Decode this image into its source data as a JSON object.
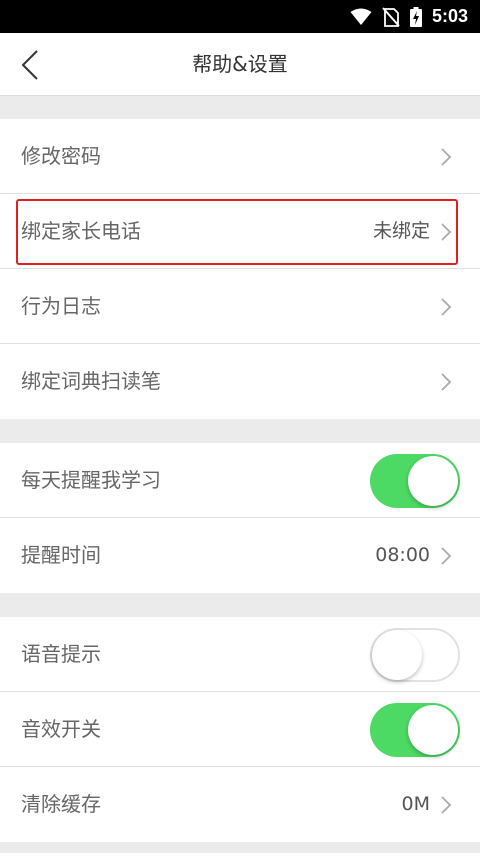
{
  "status_bar": {
    "time": "5:03",
    "icons": [
      "wifi-icon",
      "no-sim-icon",
      "battery-charging-icon"
    ]
  },
  "header": {
    "title": "帮助&设置",
    "back_icon": "back-arrow-icon"
  },
  "group1": {
    "items": [
      {
        "label": "修改密码",
        "value": ""
      },
      {
        "label": "绑定家长电话",
        "value": "未绑定"
      },
      {
        "label": "行为日志",
        "value": ""
      },
      {
        "label": "绑定词典扫读笔",
        "value": ""
      }
    ]
  },
  "group2": {
    "items": [
      {
        "label": "每天提醒我学习",
        "toggle": true
      },
      {
        "label": "提醒时间",
        "value": "08:00"
      }
    ]
  },
  "group3": {
    "items": [
      {
        "label": "语音提示",
        "toggle": false
      },
      {
        "label": "音效开关",
        "toggle": true
      },
      {
        "label": "清除缓存",
        "value": "0M"
      }
    ]
  },
  "colors": {
    "toggle_on": "#4cd964",
    "highlight": "#e02020",
    "background": "#ebebeb"
  }
}
